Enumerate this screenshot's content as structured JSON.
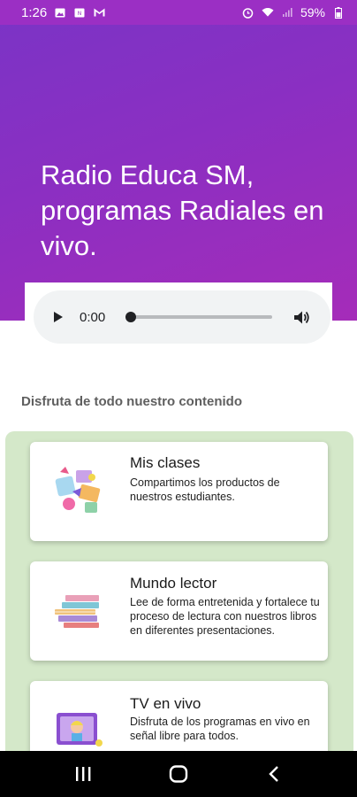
{
  "status_bar": {
    "time": "1:26",
    "battery": "59%",
    "left_icons": [
      "photo-icon",
      "nfc-icon",
      "gmail-icon"
    ],
    "right_icons": [
      "alarm-icon",
      "wifi-icon",
      "signal-icon",
      "battery-icon"
    ]
  },
  "hero": {
    "title": "Radio Educa SM, programas Radiales en vivo.",
    "gradient_colors": [
      "#7a34c6",
      "#a52cb9"
    ]
  },
  "audio_player": {
    "current_time": "0:00",
    "progress": 0
  },
  "content": {
    "section_title": "Disfruta de todo nuestro contenido",
    "cards": [
      {
        "title": "Mis clases",
        "description": "Compartimos los productos de nuestros estudiantes.",
        "icon": "classroom-collage-icon"
      },
      {
        "title": "Mundo lector",
        "description": "Lee de forma entretenida y fortalece tu proceso de lectura con nuestros libros en diferentes presentaciones.",
        "icon": "books-stack-icon"
      },
      {
        "title": "TV en vivo",
        "description": "Disfruta de los programas en vivo en señal libre para todos.",
        "icon": "tv-kid-icon"
      }
    ]
  },
  "colors": {
    "accent": "#8b2fc2",
    "cards_background": "#d4e8c9"
  }
}
